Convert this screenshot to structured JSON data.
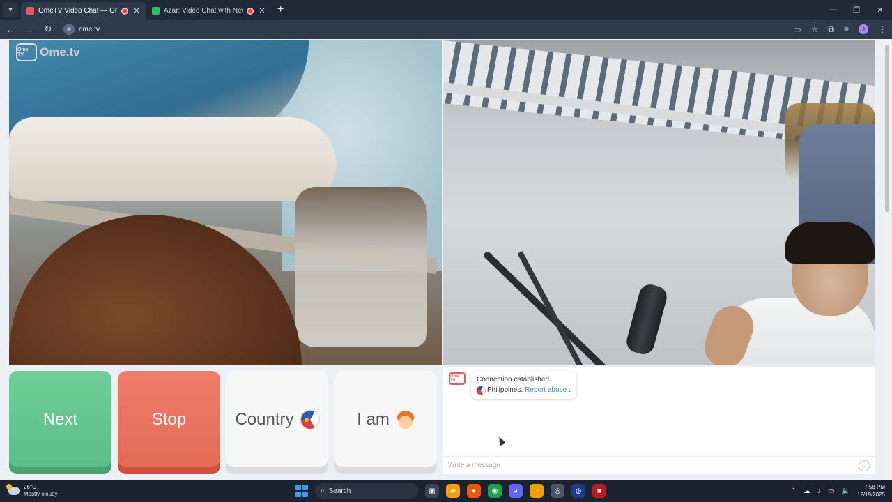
{
  "browser": {
    "tabs": [
      {
        "title": "OmeTV Video Chat — Ome",
        "active": true,
        "favicon_color": "#e25e5e"
      },
      {
        "title": "Azar: Video Chat with New",
        "active": false,
        "favicon_color": "#22c55e"
      }
    ],
    "new_tab": "+",
    "url": "ome.tv",
    "profile_initial": "J"
  },
  "video": {
    "logo_badge": "Ome TV",
    "logo_text": "Ome.tv"
  },
  "buttons": {
    "next": "Next",
    "stop": "Stop",
    "country": "Country",
    "iam": "I am"
  },
  "chat": {
    "logo": "Ome TV",
    "message_line1": "Connection established.",
    "country": "Philippines.",
    "report": "Report abuse",
    "period": ".",
    "input_placeholder": "Write a message"
  },
  "taskbar": {
    "temp": "26°C",
    "weather": "Mostly cloudy",
    "search": "Search",
    "time": "7:58 PM",
    "date": "12/19/2025"
  },
  "colors": {
    "next": "#6fcf97",
    "stop": "#ef7d6a",
    "link": "#3a8fb7"
  }
}
